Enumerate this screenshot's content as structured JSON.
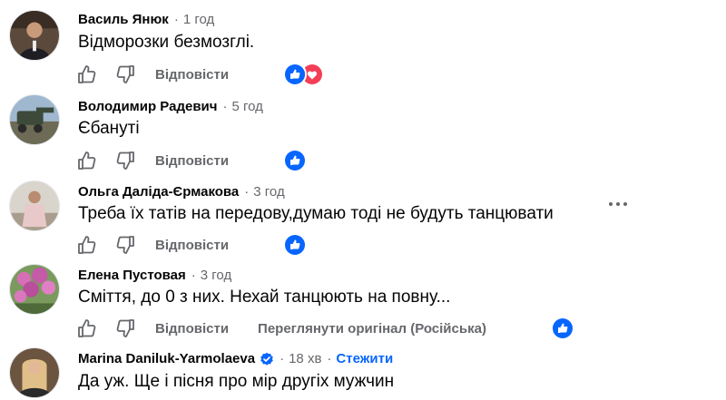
{
  "comments": [
    {
      "author": "Василь Янюк",
      "time": "1 год",
      "text": "Відморозки безмозглі.",
      "reply_label": "Відповісти",
      "reactions": [
        "like-icon",
        "love-icon"
      ]
    },
    {
      "author": "Володимир Радевич",
      "time": "5 год",
      "text": "Єбануті",
      "reply_label": "Відповісти",
      "reactions": [
        "like-icon"
      ]
    },
    {
      "author": "Ольга Даліда-Єрмакова",
      "time": "3 год",
      "text": "Треба їх татів на передову,думаю тоді не будуть танцювати",
      "reply_label": "Відповісти",
      "reactions": [
        "like-icon"
      ],
      "has_more_menu": true
    },
    {
      "author": "Елена Пустовая",
      "time": "3 год",
      "text": "Сміття, до 0 з них. Нехай танцюють на повну...",
      "reply_label": "Відповісти",
      "see_original_label": "Переглянути оригінал (Російська)",
      "reactions": [
        "like-icon"
      ]
    },
    {
      "author": "Marina Daniluk-Yarmolaeva",
      "verified": true,
      "time": "18 хв",
      "follow_label": "Стежити",
      "text": "Да уж. Ще і пісня про мір другіх мужчин"
    }
  ],
  "separator": "·",
  "colors": {
    "like_blue": "#0866ff",
    "love_red": "#f33e58",
    "secondary_text": "#65676b",
    "primary_text": "#050505"
  }
}
